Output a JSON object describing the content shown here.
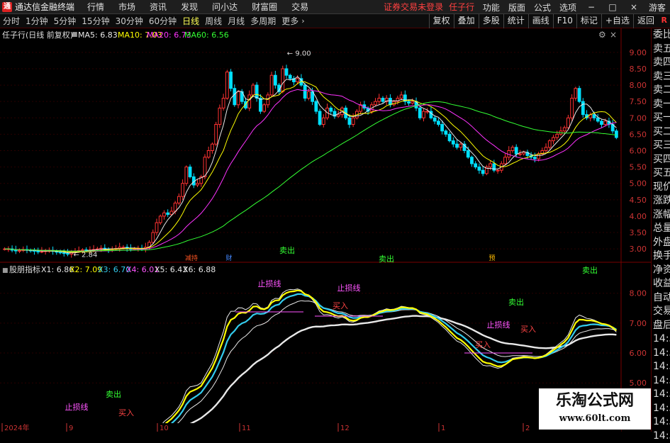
{
  "app": {
    "logo": "通",
    "title": "通达信金融终端",
    "menu": [
      "行情",
      "市场",
      "资讯",
      "发现",
      "问小达",
      "财富圈",
      "交易"
    ],
    "warning": "证券交易未登录",
    "stock_name": "任子行",
    "right_menu": [
      "功能",
      "版面",
      "公式",
      "选项",
      "游客"
    ],
    "win_buttons": [
      "−",
      "□",
      "×"
    ]
  },
  "toolbar": {
    "timeframes": [
      "分时",
      "1分钟",
      "5分钟",
      "15分钟",
      "30分钟",
      "60分钟",
      "日线",
      "周线",
      "月线",
      "多周期"
    ],
    "active": "日线",
    "more": "更多",
    "buttons": [
      "复权",
      "叠加",
      "多股",
      "统计",
      "画线",
      "F10",
      "标记",
      "+自选",
      "返回"
    ],
    "r_tag": "R"
  },
  "side_panel": [
    "委比",
    "卖五",
    "卖四",
    "卖三",
    "卖二",
    "卖一",
    "买一",
    "买二",
    "买三",
    "买四",
    "买五",
    "现价",
    "涨跌",
    "涨幅",
    "总量",
    "外盘",
    "换手",
    "净资",
    "收益",
    "自动",
    "交易",
    "盘后",
    "14:56",
    "14:56",
    "14:56",
    "14:56",
    "14:56",
    "14:56",
    "14:56",
    "14:56"
  ],
  "price_legend": {
    "title": "任子行(日线 前复权)",
    "items": [
      {
        "label": "MA5: 6.83",
        "color": "#e8e8e8"
      },
      {
        "label": "MA10: 7.03",
        "color": "#ffff00"
      },
      {
        "label": "MA20: 6.73",
        "color": "#ff33ff"
      },
      {
        "label": "MA60: 6.56",
        "color": "#33ff33"
      }
    ]
  },
  "ind_legend": {
    "title": "股朋指标",
    "items": [
      {
        "label": "X1: 6.86",
        "color": "#e8e8e8"
      },
      {
        "label": "X2: 7.09",
        "color": "#ffff00"
      },
      {
        "label": "X3: 6.70",
        "color": "#33ccee"
      },
      {
        "label": "X4: 6.01",
        "color": "#ff55ff"
      },
      {
        "label": "X5: 6.43",
        "color": "#e8e8e8"
      },
      {
        "label": "X6: 6.88",
        "color": "#e8e8e8"
      }
    ]
  },
  "markers": {
    "high": "9.00",
    "low": "2.84",
    "events": [
      {
        "label": "减持",
        "color": "#ff5522"
      },
      {
        "label": "财",
        "color": "#4488ff"
      },
      {
        "label": "预",
        "color": "#ffbb00"
      }
    ]
  },
  "signals": [
    "卖出",
    "卖出",
    "卖出",
    "卖出",
    "卖出",
    "止损线",
    "止损线",
    "止损线",
    "止损线",
    "买入",
    "买入",
    "买入",
    "买入"
  ],
  "date_axis": [
    "2024年",
    "9",
    "10",
    "11",
    "12",
    "1",
    "2"
  ],
  "watermark": {
    "line1": "乐淘公式网",
    "line2": "www.60lt.com"
  },
  "chart_data": {
    "type": "candlestick",
    "title": "任子行(日线 前复权)",
    "yticks_price": [
      3.0,
      3.5,
      4.0,
      4.5,
      5.0,
      5.5,
      6.0,
      6.5,
      7.0,
      7.5,
      8.0,
      8.5,
      9.0
    ],
    "ylim_price": [
      2.7,
      9.3
    ],
    "yticks_indicator": [
      5.0,
      6.0,
      7.0,
      8.0
    ],
    "ylim_indicator": [
      3.7,
      8.8
    ],
    "close": [
      3.0,
      3.0,
      2.96,
      2.95,
      2.95,
      2.98,
      2.96,
      2.95,
      2.93,
      2.92,
      2.92,
      2.94,
      2.95,
      2.93,
      2.9,
      2.88,
      2.86,
      2.84,
      2.9,
      2.93,
      2.95,
      2.97,
      2.96,
      2.97,
      2.98,
      3.0,
      3.02,
      3.0,
      2.98,
      3.0,
      3.01,
      3.05,
      3.05,
      3.02,
      3.0,
      3.01,
      3.02,
      3.0,
      3.05,
      3.2,
      3.5,
      3.8,
      4.0,
      4.1,
      4.05,
      4.15,
      4.4,
      4.6,
      5.0,
      5.5,
      5.2,
      4.95,
      5.0,
      5.2,
      5.8,
      6.0,
      6.2,
      6.8,
      7.3,
      7.6,
      8.4,
      7.9,
      7.4,
      7.8,
      7.5,
      7.3,
      7.7,
      8.0,
      7.6,
      7.2,
      7.4,
      7.7,
      8.3,
      8.0,
      7.8,
      8.5,
      8.3,
      8.2,
      8.1,
      8.2,
      8.0,
      7.6,
      7.8,
      7.5,
      7.2,
      6.8,
      7.0,
      7.3,
      7.2,
      7.05,
      7.1,
      7.3,
      7.0,
      6.8,
      7.0,
      7.2,
      7.4,
      7.3,
      7.2,
      7.4,
      7.5,
      7.6,
      7.5,
      7.6,
      7.4,
      7.5,
      7.6,
      7.7,
      7.5,
      7.45,
      7.5,
      7.3,
      7.0,
      7.2,
      7.2,
      7.0,
      6.9,
      6.8,
      6.6,
      6.5,
      6.3,
      6.2,
      6.1,
      6.2,
      6.0,
      5.8,
      5.6,
      5.5,
      5.4,
      5.3,
      5.5,
      5.6,
      5.4,
      5.4,
      5.6,
      5.8,
      6.0,
      6.1,
      5.9,
      5.9,
      5.95,
      5.85,
      5.8,
      5.75,
      5.9,
      6.0,
      6.1,
      6.3,
      6.4,
      6.5,
      6.6,
      6.7,
      7.0,
      7.6,
      7.9,
      7.5,
      7.1,
      7.0,
      7.1,
      7.0,
      6.9,
      6.8,
      6.9,
      6.8,
      6.6,
      6.4
    ]
  }
}
